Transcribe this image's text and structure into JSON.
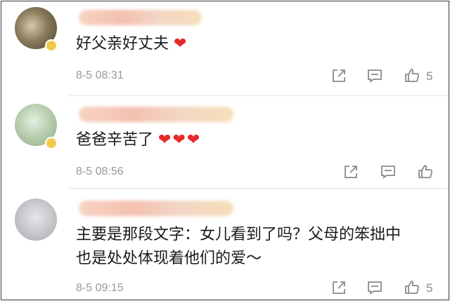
{
  "comments": [
    {
      "text": "好父亲好丈夫",
      "hearts": "❤",
      "time": "8-5 08:31",
      "likes": "5"
    },
    {
      "text": "爸爸辛苦了",
      "hearts": "❤❤❤",
      "time": "8-5 08:56",
      "likes": ""
    },
    {
      "text_line1": "主要是那段文字：女儿看到了吗？父母的笨拙中",
      "text_line2": "也是处处体现着他们的爱～",
      "time": "8-5 09:15",
      "likes": "5"
    }
  ],
  "colors": {
    "heart": "#e8282a",
    "text": "#1a1a1a",
    "meta": "#9a9a9a",
    "icon": "#8a8a8a"
  },
  "icons": [
    "share-icon",
    "comment-icon",
    "like-icon"
  ]
}
